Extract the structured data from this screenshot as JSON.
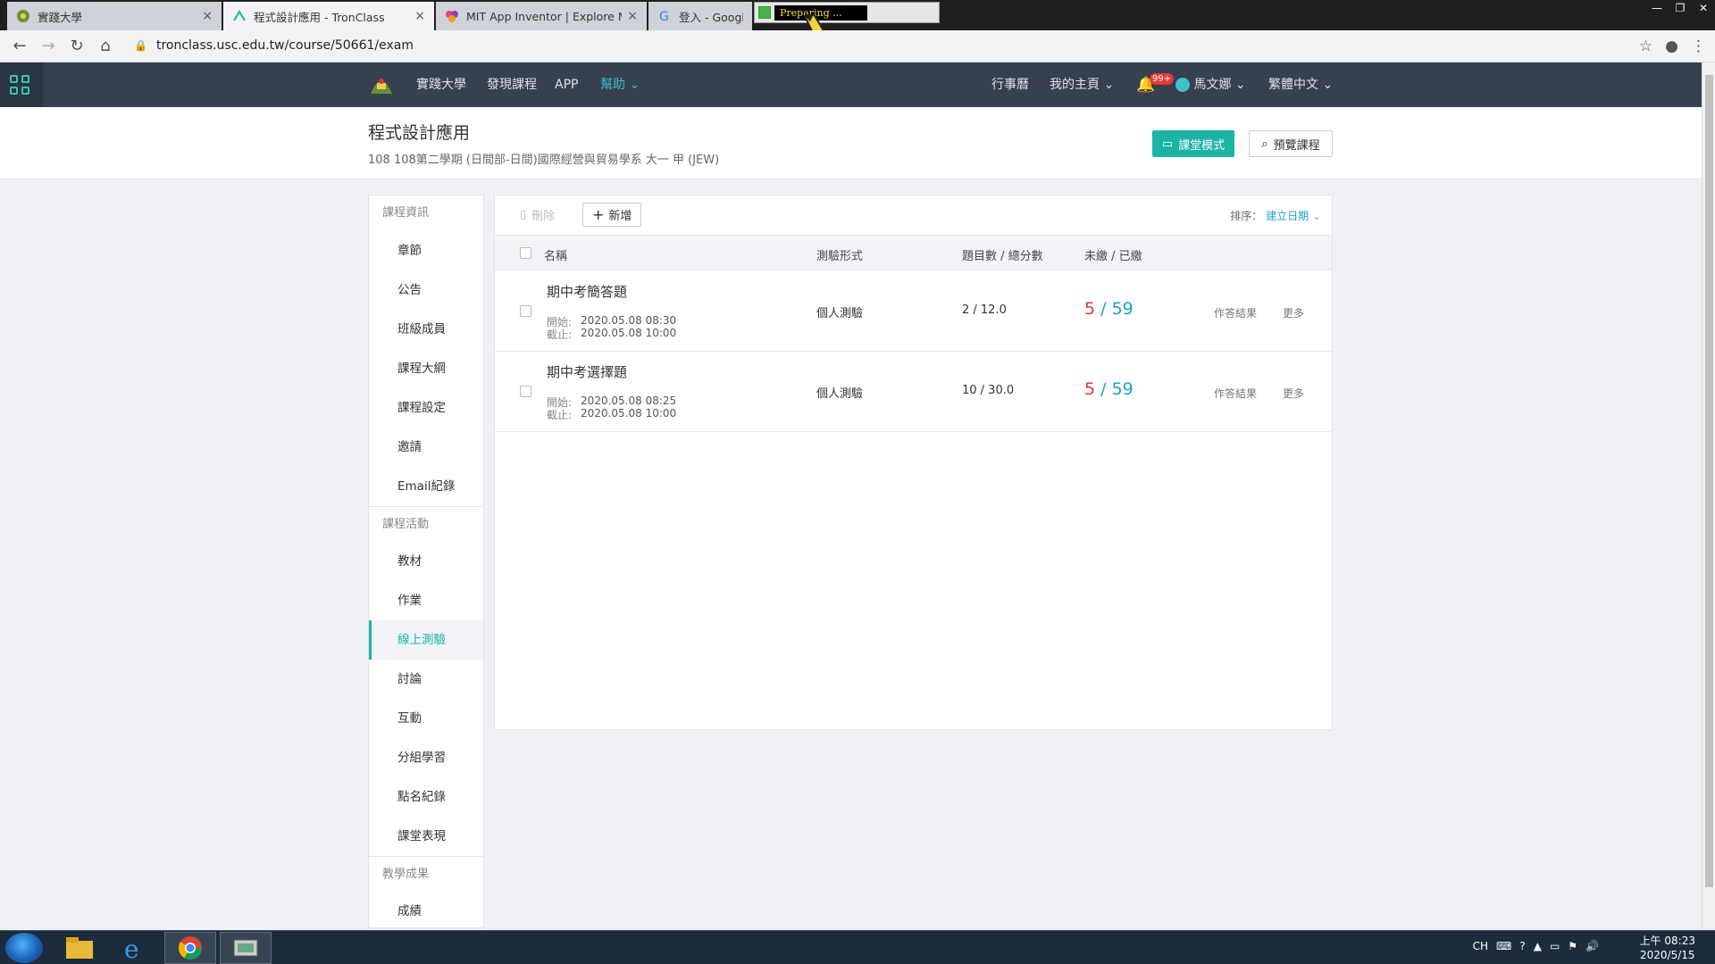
{
  "browser": {
    "tabs": [
      {
        "title": "實踐大學",
        "close": "×"
      },
      {
        "title": "程式設計應用 - TronClass",
        "close": "×"
      },
      {
        "title": "MIT App Inventor | Explore MIT",
        "close": "×"
      },
      {
        "title": "登入 - Google",
        "close": ""
      }
    ],
    "preparing": "Preparing ...",
    "url": "tronclass.usc.edu.tw/course/50661/exam",
    "window_controls": [
      "—",
      "❐",
      "✕"
    ]
  },
  "header": {
    "nav": [
      "實踐大學",
      "發現課程",
      "APP",
      "幫助"
    ],
    "right": {
      "calendar": "行事曆",
      "my_home": "我的主頁",
      "notif_badge": "99+",
      "user": "馬文娜",
      "lang": "繁體中文"
    }
  },
  "course": {
    "title": "程式設計應用",
    "subtitle": "108 108第二學期 (日間部-日間)國際經營與貿易學系 大一 甲 (JEW)",
    "btn_classroom": "課堂模式",
    "btn_preview": "預覽課程"
  },
  "sidebar": {
    "sections": [
      {
        "title": "課程資訊",
        "items": [
          "章節",
          "公告",
          "班級成員",
          "課程大綱",
          "課程設定",
          "邀請",
          "Email紀錄"
        ]
      },
      {
        "title": "課程活動",
        "items": [
          "教材",
          "作業",
          "線上測驗",
          "討論",
          "互動",
          "分組學習",
          "點名紀錄",
          "課堂表現"
        ]
      },
      {
        "title": "教學成果",
        "items": [
          "成績"
        ]
      }
    ],
    "active": "線上測驗"
  },
  "toolbar": {
    "delete_label": "刪除",
    "add_label": "新增",
    "sort_label": "排序：",
    "sort_value": "建立日期"
  },
  "table": {
    "headers": [
      "名稱",
      "測驗形式",
      "題目數 / 總分數",
      "未繳 / 已繳"
    ],
    "rows": [
      {
        "title": "期中考簡答題",
        "start_label": "開始:",
        "start": "2020.05.08 08:30",
        "end_label": "截止:",
        "end": "2020.05.08 10:00",
        "type": "個人測驗",
        "score": "2 / 12.0",
        "unsubmitted": "5",
        "sep": " / ",
        "submitted": "59",
        "result_link": "作答結果",
        "more_link": "更多"
      },
      {
        "title": "期中考選擇題",
        "start_label": "開始:",
        "start": "2020.05.08 08:25",
        "end_label": "截止:",
        "end": "2020.05.08 10:00",
        "type": "個人測驗",
        "score": "10 / 30.0",
        "unsubmitted": "5",
        "sep": " / ",
        "submitted": "59",
        "result_link": "作答結果",
        "more_link": "更多"
      }
    ]
  },
  "taskbar": {
    "tray": [
      "CH",
      "⌨",
      "?",
      "▲",
      "▭",
      "⚑",
      "🔊"
    ],
    "time": "上午 08:23",
    "date": "2020/5/15"
  },
  "colors": {
    "header_bg": "#36404f",
    "accent": "#1db3a7",
    "red": "#e53935",
    "blue": "#1da1c9"
  }
}
